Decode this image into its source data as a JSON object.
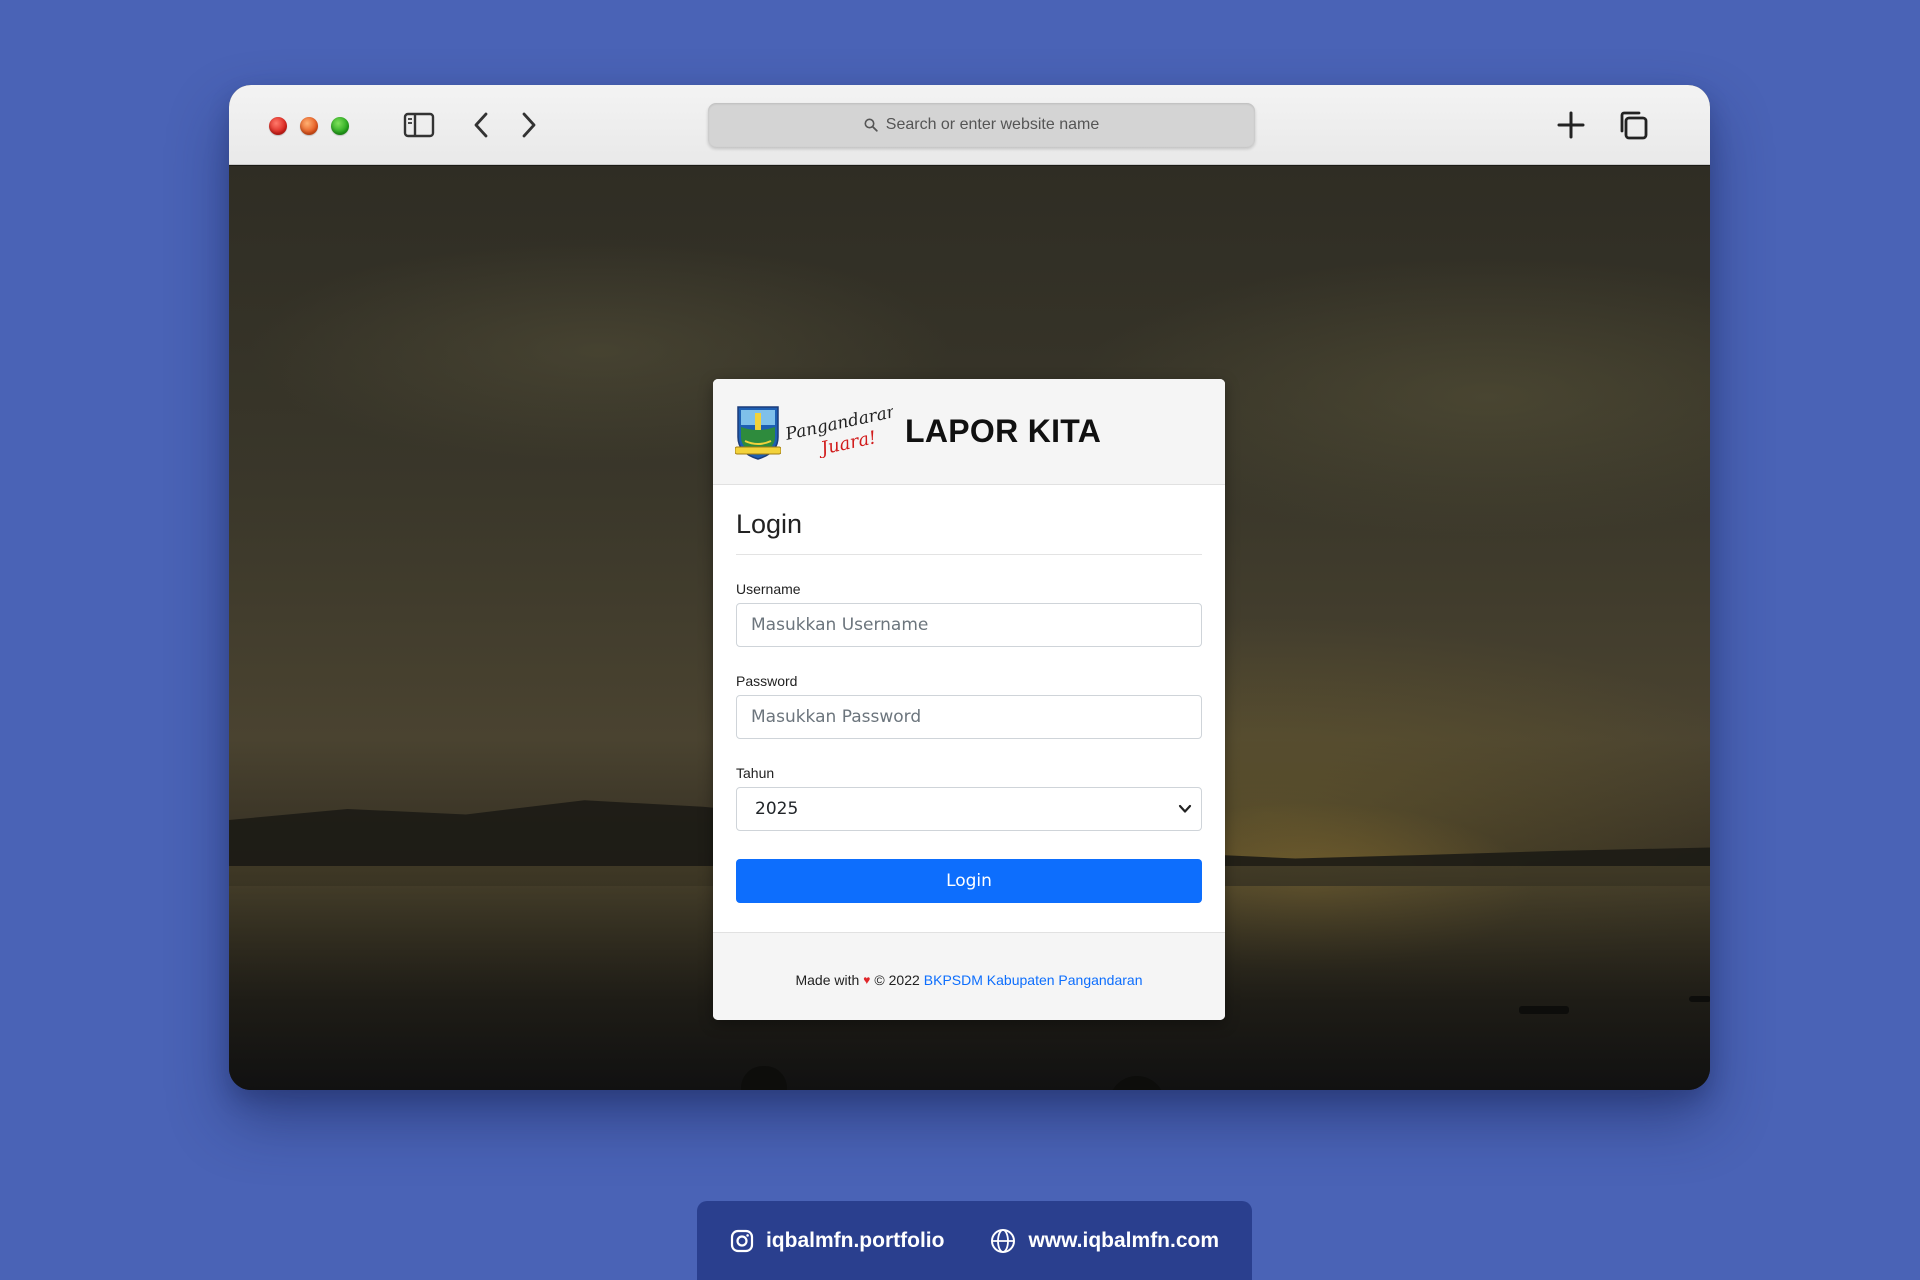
{
  "browser": {
    "address_placeholder": "Search or enter website name"
  },
  "header": {
    "logo_script_line1": "Pangandaran",
    "logo_script_line2": "Juara!",
    "app_title": "LAPOR KITA"
  },
  "login": {
    "heading": "Login",
    "username_label": "Username",
    "username_placeholder": "Masukkan Username",
    "password_label": "Password",
    "password_placeholder": "Masukkan Password",
    "year_label": "Tahun",
    "year_selected": "2025",
    "submit_label": "Login"
  },
  "footer": {
    "made_with": "Made with",
    "heart": "♥",
    "copyright": "© 2022",
    "link_text": "BKPSDM Kabupaten Pangandaran"
  },
  "social": {
    "instagram": "iqbalmfn.portfolio",
    "website": "www.iqbalmfn.com"
  },
  "colors": {
    "page_bg": "#4a63b6",
    "primary": "#0d6efd",
    "social_bar": "#2a3f8e"
  }
}
